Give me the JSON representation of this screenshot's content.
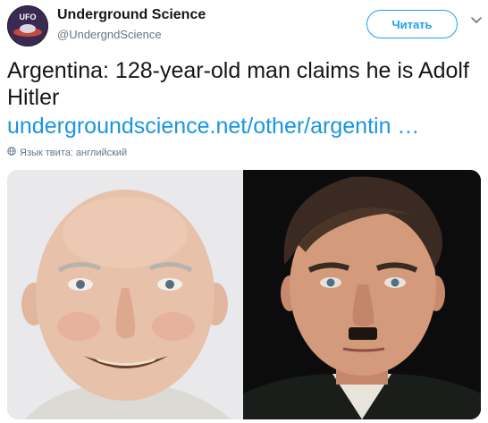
{
  "account": {
    "name": "Underground Science",
    "handle": "@UndergndScience",
    "avatar_text": "UFO"
  },
  "follow_button": {
    "label": "Читать"
  },
  "tweet": {
    "text": "Argentina: 128-year-old man claims he is Adolf Hitler",
    "link": "undergroundscience.net/other/argentin …",
    "language_note": "Язык твита: английский"
  },
  "icons": {
    "more": "chevron-down-icon",
    "language": "globe-icon"
  },
  "colors": {
    "accent": "#1da1f2",
    "link": "#1b95e0",
    "text": "#14171a",
    "secondary": "#657786"
  }
}
